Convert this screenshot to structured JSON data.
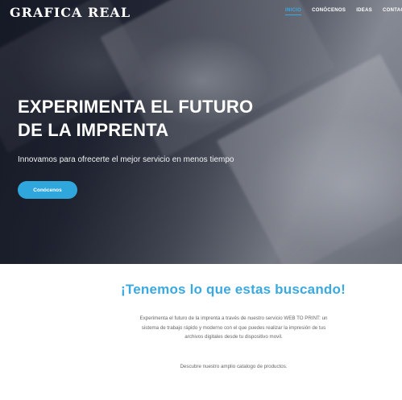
{
  "brand": {
    "logo_text": "GRAFICA REAL"
  },
  "nav": {
    "items": [
      {
        "label": "INICIO",
        "active": true
      },
      {
        "label": "CONÓCENOS",
        "active": false
      },
      {
        "label": "IDEAS",
        "active": false
      },
      {
        "label": "CONTACTO",
        "active": false
      }
    ]
  },
  "hero": {
    "title_line1": "EXPERIMENTA EL FUTURO",
    "title_line2": "DE LA IMPRENTA",
    "subtitle": "Innovamos para ofrecerte el mejor servicio en menos tiempo",
    "cta_label": "Conócenos"
  },
  "section": {
    "heading": "¡Tenemos lo que estas buscando!",
    "body": "Experimenta el futuro de la imprenta a través de nuestro servicio WEB TO PRINT: un sistema de trabajo rápido y moderno con el que puedes realizar la impresión de tus archivos digitales desde tu dispositivo movil.",
    "note": "Descubre nuestro amplio catalogo de productos."
  },
  "colors": {
    "accent": "#3aa9e0",
    "button": "#2fa7dd",
    "hero_dark": "#1d2130",
    "body_text": "#666666"
  }
}
